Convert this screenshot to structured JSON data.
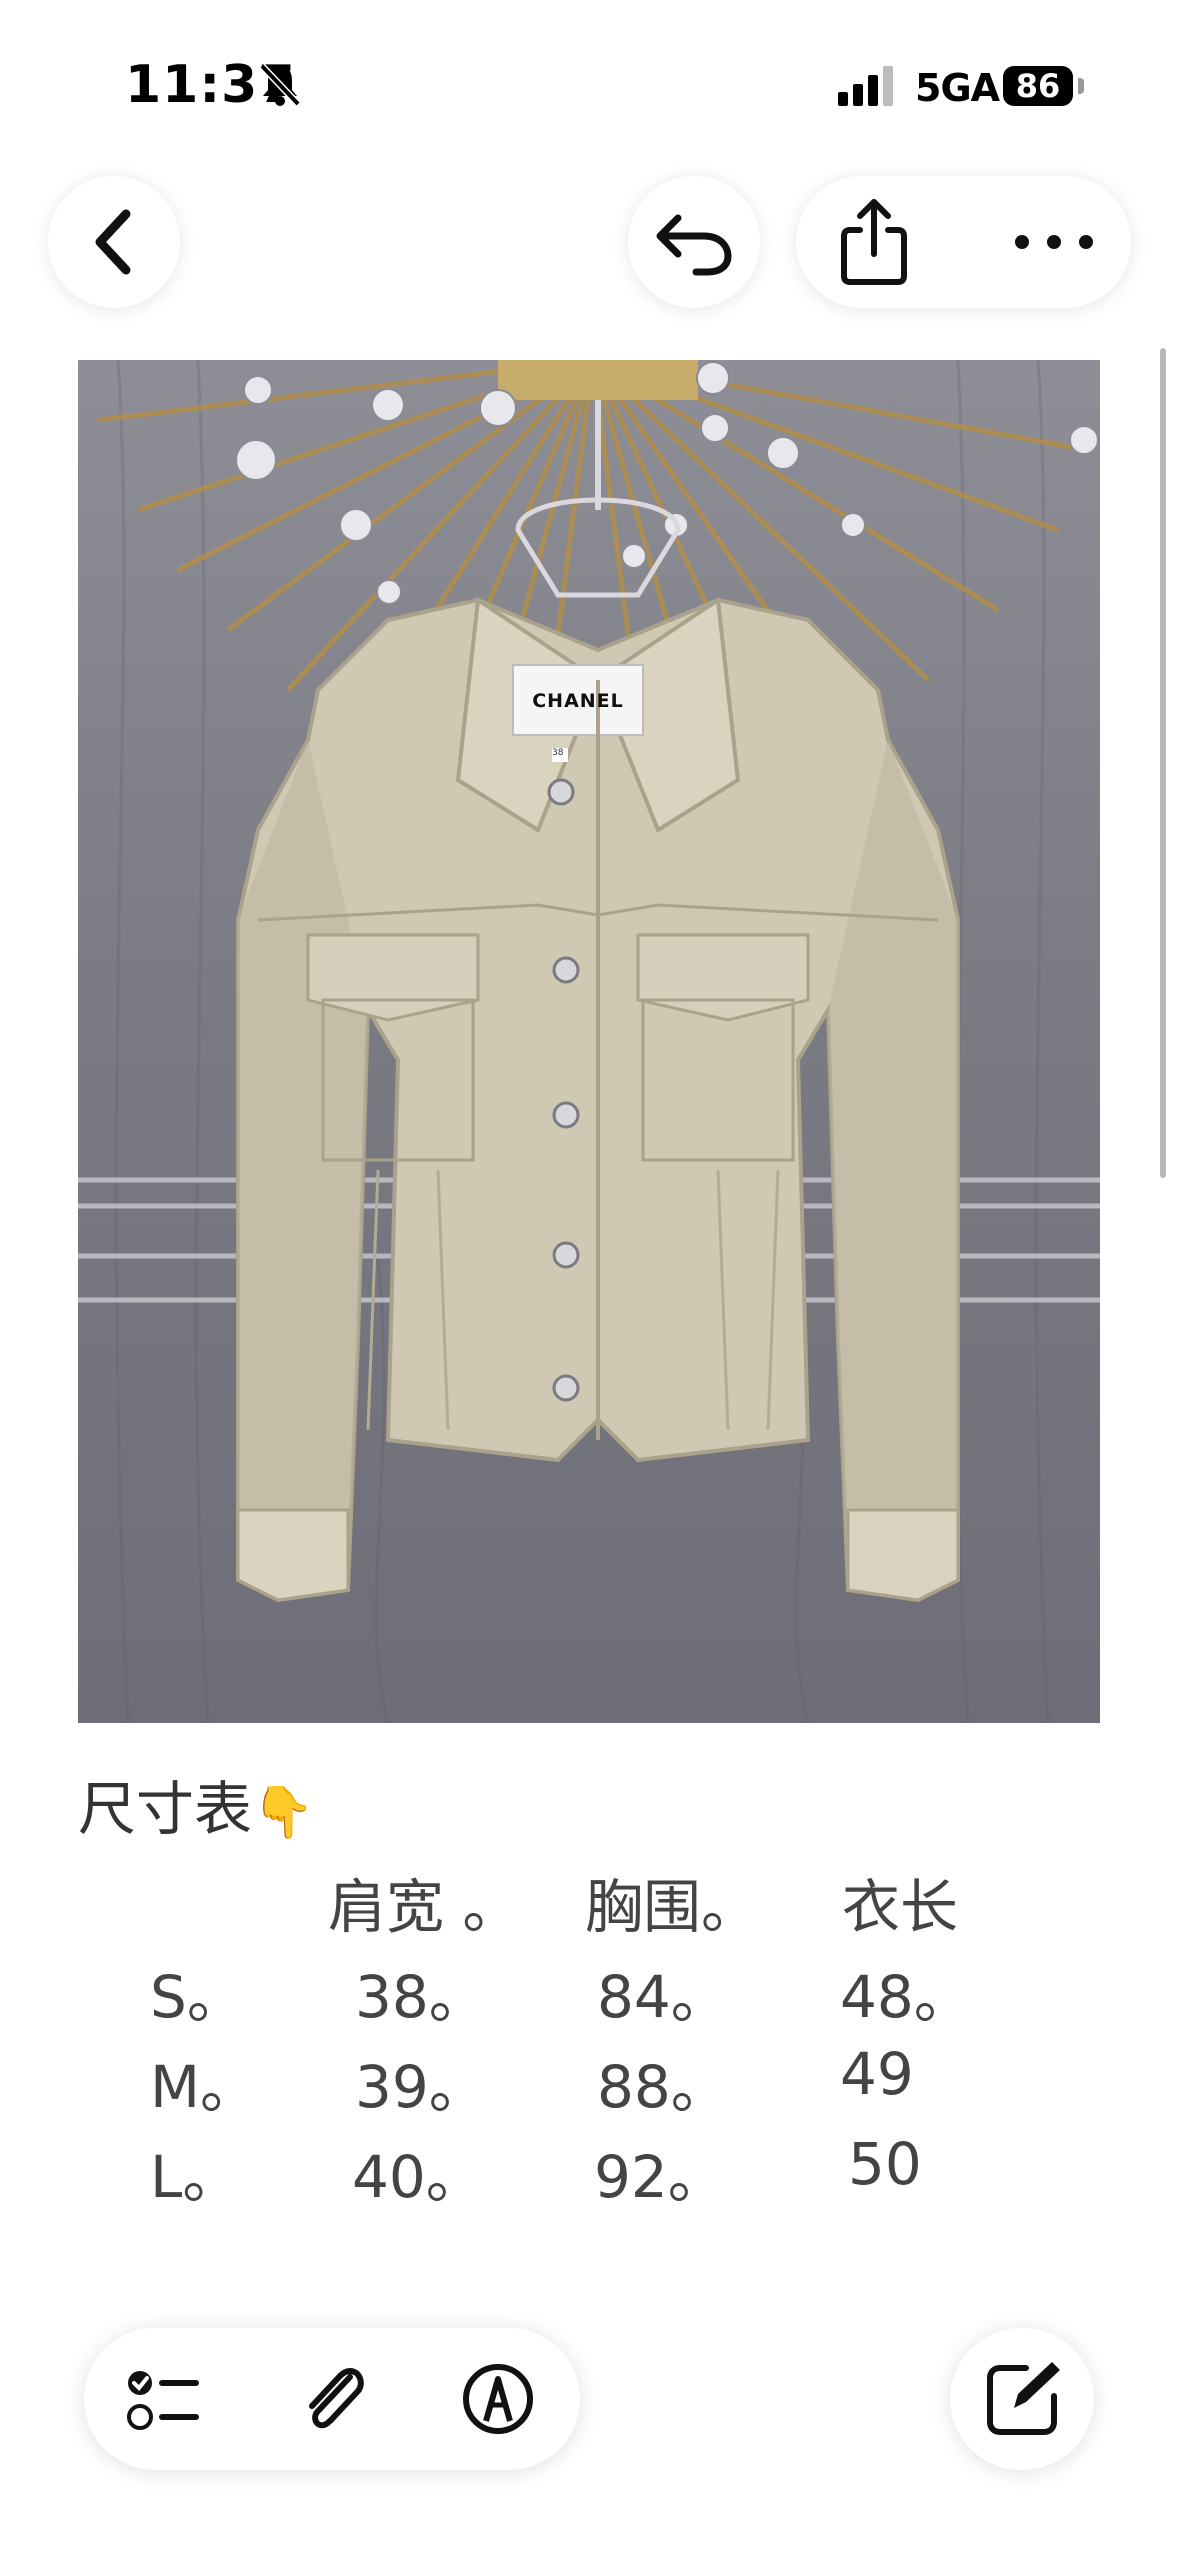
{
  "status_bar": {
    "time": "11:37",
    "network": "5GA",
    "battery": "86"
  },
  "nav": {
    "back_icon": "chevron-left-icon",
    "undo_icon": "undo-icon",
    "share_icon": "share-icon",
    "more_icon": "ellipsis-icon"
  },
  "photo": {
    "label_brand": "CHANEL",
    "label_size": "38"
  },
  "note": {
    "title": "尺寸表",
    "title_emoji": "👇",
    "headers": [
      "肩宽 。",
      "胸围。",
      "衣长"
    ],
    "rows": [
      {
        "size": "S。",
        "values": [
          "38。",
          "84。",
          "48。"
        ]
      },
      {
        "size": "M。",
        "values": [
          "39。",
          "88。",
          "49"
        ]
      },
      {
        "size": "L。",
        "values": [
          "40。",
          "92。",
          "50"
        ]
      }
    ]
  },
  "toolbar": {
    "checklist_icon": "checklist-icon",
    "attachment_icon": "paperclip-icon",
    "markup_icon": "pen-markup-icon",
    "compose_icon": "compose-icon"
  },
  "colors": {
    "jacket": "#cfc8b3",
    "background": "#7f7f88",
    "sunburst": "#b08e4e"
  }
}
